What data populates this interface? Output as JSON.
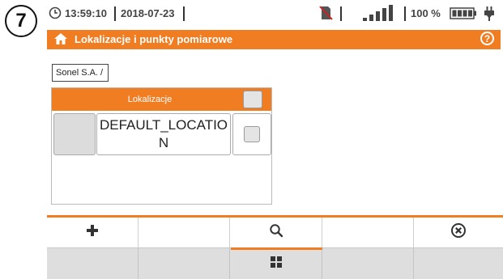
{
  "callout": {
    "number": "7"
  },
  "status": {
    "time": "13:59:10",
    "date": "2018-07-23",
    "battery_percent": "100 %",
    "signal_bars": 5,
    "icons": [
      "clock-icon",
      "no-sd-card-icon",
      "signal-strength-icon",
      "battery-icon",
      "power-plug-icon"
    ]
  },
  "titlebar": {
    "title": "Lokalizacje i punkty pomiarowe",
    "help_symbol": "?",
    "icons": [
      "home-icon",
      "help-icon"
    ]
  },
  "breadcrumb": {
    "path": "Sonel S.A. /"
  },
  "panel": {
    "header_label": "Lokalizacje",
    "rows": [
      {
        "name": "DEFAULT_LOCATION",
        "checked": false
      }
    ]
  },
  "toolbar": {
    "row1": [
      "add-icon",
      "",
      "search-icon",
      "",
      "cancel-icon"
    ],
    "row2": [
      "",
      "",
      "grid-view-icon",
      "",
      ""
    ],
    "active_index": 2
  },
  "colors": {
    "accent": "#f07d22",
    "toolbar_bottom": "#dedede",
    "text": "#222222"
  }
}
